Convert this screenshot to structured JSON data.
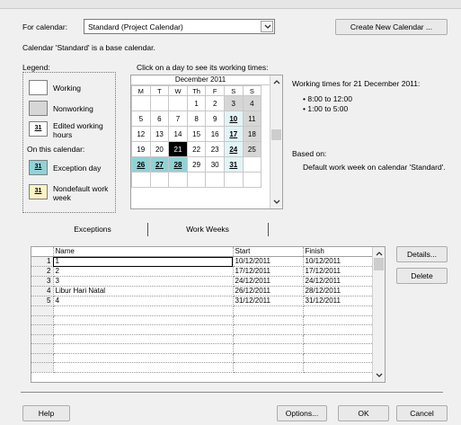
{
  "header": {
    "for_calendar_label": "For calendar:",
    "calendar_value": "Standard (Project Calendar)",
    "create_button": "Create New Calendar ...",
    "base_text": "Calendar 'Standard' is a base calendar."
  },
  "legend": {
    "title": "Legend:",
    "items": [
      "Working",
      "Nonworking",
      "Edited working hours"
    ],
    "on_this_calendar": "On this calendar:",
    "items2": [
      "Exception day",
      "Nondefault work week"
    ],
    "sample_day": "31"
  },
  "calendar": {
    "instruction": "Click on a day to see its working times:",
    "month": "December 2011",
    "dow": [
      "M",
      "T",
      "W",
      "Th",
      "F",
      "S",
      "S"
    ],
    "weeks": [
      [
        "",
        "",
        "",
        "1",
        "2",
        "3",
        "4"
      ],
      [
        "5",
        "6",
        "7",
        "8",
        "9",
        "10",
        "11"
      ],
      [
        "12",
        "13",
        "14",
        "15",
        "16",
        "17",
        "18"
      ],
      [
        "19",
        "20",
        "21",
        "22",
        "23",
        "24",
        "25"
      ],
      [
        "26",
        "27",
        "28",
        "29",
        "30",
        "31",
        ""
      ],
      [
        "",
        "",
        "",
        "",
        "",
        "",
        ""
      ]
    ]
  },
  "working_times": {
    "title": "Working times for 21 December 2011:",
    "times": [
      "8:00 to 12:00",
      "1:00 to 5:00"
    ],
    "based_on_label": "Based on:",
    "based_on_text": "Default work week on calendar 'Standard'."
  },
  "tabs": [
    "Exceptions",
    "Work Weeks"
  ],
  "grid": {
    "columns": [
      "Name",
      "Start",
      "Finish"
    ],
    "rows": [
      [
        "1",
        "1",
        "10/12/2011",
        "10/12/2011"
      ],
      [
        "2",
        "2",
        "17/12/2011",
        "17/12/2011"
      ],
      [
        "3",
        "3",
        "24/12/2011",
        "24/12/2011"
      ],
      [
        "4",
        "Libur Hari Natal",
        "26/12/2011",
        "28/12/2011"
      ],
      [
        "5",
        "4",
        "31/12/2011",
        "31/12/2011"
      ]
    ]
  },
  "side_buttons": [
    "Details...",
    "Delete"
  ],
  "footer": {
    "help": "Help",
    "options": "Options...",
    "ok": "OK",
    "cancel": "Cancel"
  }
}
